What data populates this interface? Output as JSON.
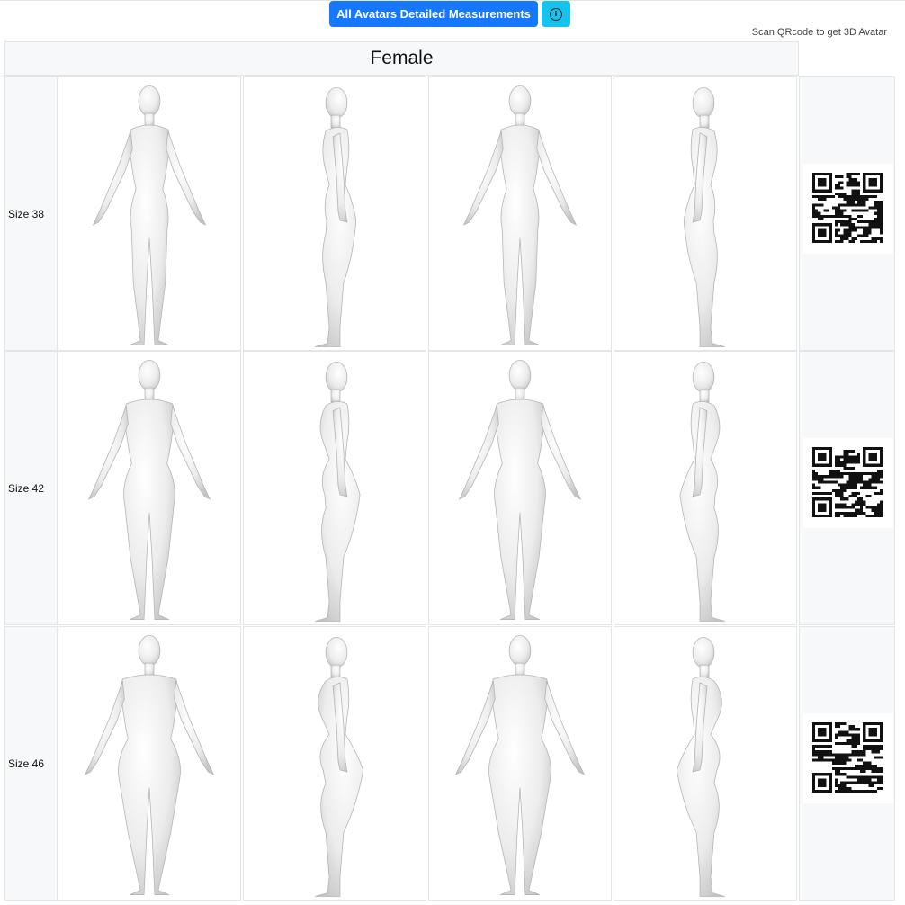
{
  "header": {
    "measurements_button": "All Avatars Detailed Measurements",
    "info_icon": "info-circle-icon",
    "scan_note": "Scan QRcode to get 3D Avatar"
  },
  "table": {
    "title": "Female",
    "rows": [
      {
        "size_label": "Size 38",
        "views": [
          "front-avatar",
          "side-avatar-left",
          "back-avatar",
          "side-avatar-right"
        ],
        "qr": "qr-code"
      },
      {
        "size_label": "Size 42",
        "views": [
          "front-avatar",
          "side-avatar-left",
          "back-avatar",
          "side-avatar-right"
        ],
        "qr": "qr-code"
      },
      {
        "size_label": "Size 46",
        "views": [
          "front-avatar",
          "side-avatar-left",
          "back-avatar",
          "side-avatar-right"
        ],
        "qr": "qr-code"
      }
    ]
  },
  "colors": {
    "primary_button": "#1677ff",
    "info_button": "#14c4ee",
    "header_cell_bg": "#f7f8f9",
    "border": "#e3e5e7"
  }
}
